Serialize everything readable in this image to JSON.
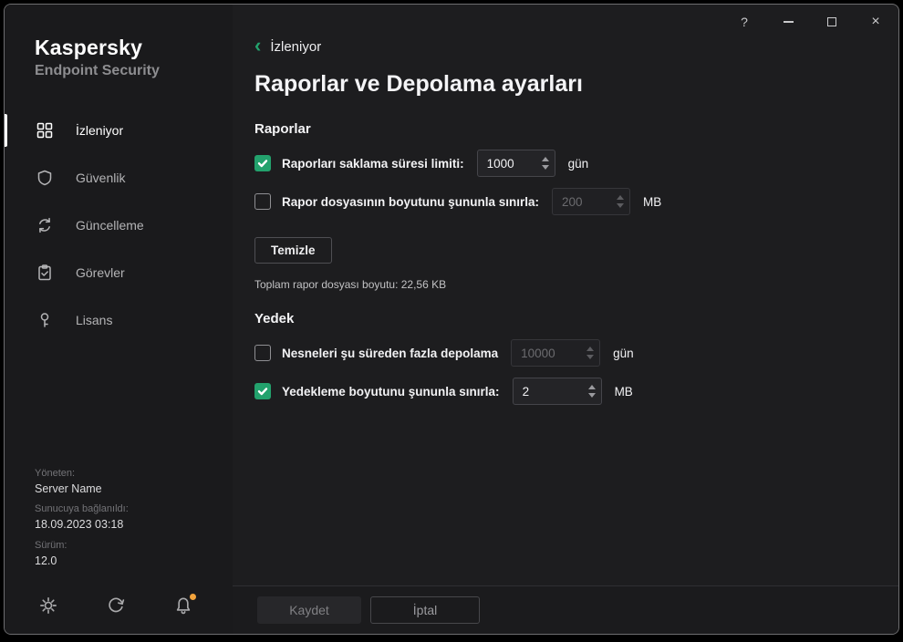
{
  "colors": {
    "accent": "#23a26d",
    "notification": "#f2a33c"
  },
  "window_controls": {
    "help_glyph": "?",
    "close_glyph": "×"
  },
  "brand": {
    "name": "Kaspersky",
    "product": "Endpoint Security"
  },
  "sidebar": {
    "items": [
      {
        "label": "İzleniyor",
        "icon": "monitoring-grid-icon",
        "active": true
      },
      {
        "label": "Güvenlik",
        "icon": "shield-icon",
        "active": false
      },
      {
        "label": "Güncelleme",
        "icon": "update-refresh-icon",
        "active": false
      },
      {
        "label": "Görevler",
        "icon": "tasks-clipboard-icon",
        "active": false
      },
      {
        "label": "Lisans",
        "icon": "license-key-icon",
        "active": false
      }
    ],
    "info": {
      "managed_label": "Yöneten:",
      "managed_value": "Server Name",
      "connected_label": "Sunucuya bağlanıldı:",
      "connected_value": "18.09.2023 03:18",
      "version_label": "Sürüm:",
      "version_value": "12.0"
    }
  },
  "main": {
    "back_chevron": "‹",
    "back_label": "İzleniyor",
    "title": "Raporlar ve Depolama ayarları",
    "reports": {
      "heading": "Raporlar",
      "row_retention": {
        "checked": true,
        "disabled": false,
        "label": "Raporları saklama süresi limiti:",
        "value": "1000",
        "unit": "gün"
      },
      "row_size": {
        "checked": false,
        "disabled": true,
        "label": "Rapor dosyasının boyutunu şununla sınırla:",
        "value": "200",
        "unit": "MB"
      },
      "clear_button": "Temizle",
      "total_text": "Toplam rapor dosyası boyutu: 22,56 KB"
    },
    "backup": {
      "heading": "Yedek",
      "row_retention": {
        "checked": false,
        "disabled": true,
        "label": "Nesneleri şu süreden fazla depolama",
        "value": "10000",
        "unit": "gün"
      },
      "row_size": {
        "checked": true,
        "disabled": false,
        "label": "Yedekleme boyutunu şununla sınırla:",
        "value": "2",
        "unit": "MB"
      }
    },
    "footer": {
      "save": "Kaydet",
      "cancel": "İptal"
    }
  }
}
